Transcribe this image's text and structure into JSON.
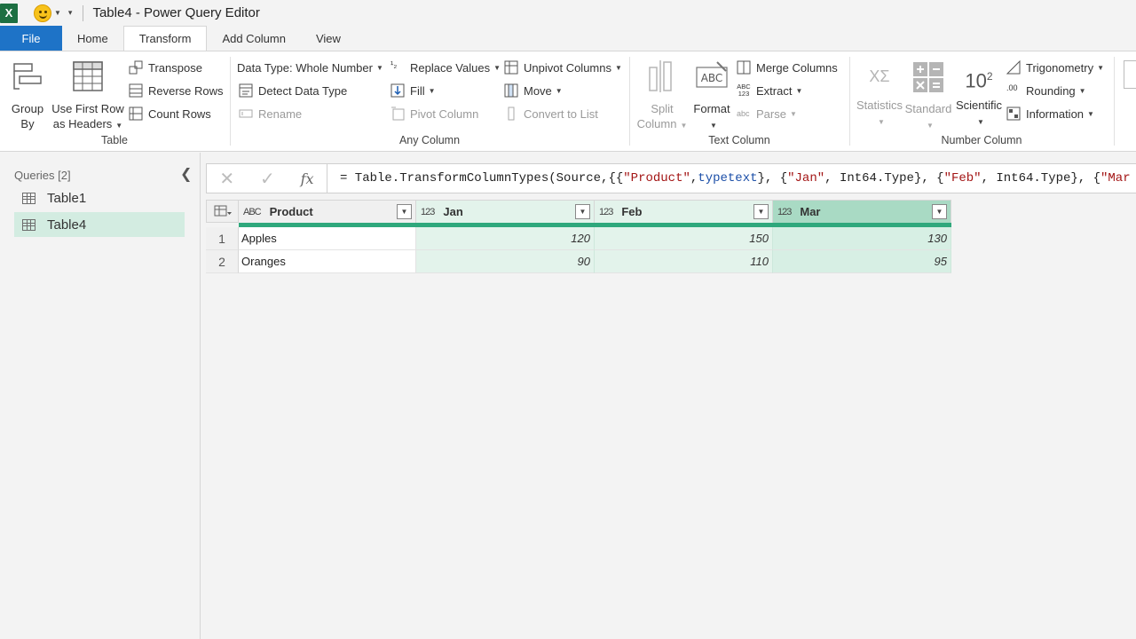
{
  "window": {
    "app_icon_letter": "X",
    "title": "Table4 - Power Query Editor"
  },
  "tabs": [
    {
      "label": "File"
    },
    {
      "label": "Home"
    },
    {
      "label": "Transform"
    },
    {
      "label": "Add Column"
    },
    {
      "label": "View"
    }
  ],
  "ribbon": {
    "table_group": {
      "label": "Table",
      "group_by": [
        "Group",
        "By"
      ],
      "use_first_row": [
        "Use First Row",
        "as Headers"
      ],
      "transpose": "Transpose",
      "reverse_rows": "Reverse Rows",
      "count_rows": "Count Rows"
    },
    "any_column_group": {
      "label": "Any Column",
      "data_type": "Data Type: Whole Number",
      "detect_data_type": "Detect Data Type",
      "rename": "Rename",
      "replace_values": "Replace Values",
      "fill": "Fill",
      "pivot_column": "Pivot Column",
      "unpivot_columns": "Unpivot Columns",
      "move": "Move",
      "convert_to_list": "Convert to List"
    },
    "text_column_group": {
      "label": "Text Column",
      "split_column": [
        "Split",
        "Column"
      ],
      "format": "Format",
      "merge_columns": "Merge Columns",
      "extract": "Extract",
      "parse": "Parse",
      "abc_icon_text": "ABC",
      "abc123_icon_text": [
        "ABC",
        "123"
      ],
      "abc_small_icon_text": "abc"
    },
    "number_column_group": {
      "label": "Number Column",
      "statistics": "Statistics",
      "standard": "Standard",
      "scientific": "Scientific",
      "scientific_icon_text": "10",
      "scientific_icon_sup": "2",
      "statistics_icon_text": "XΣ",
      "trigonometry": "Trigonometry",
      "rounding": "Rounding",
      "information": "Information"
    }
  },
  "queries": {
    "header": "Queries [2]",
    "items": [
      {
        "name": "Table1",
        "selected": false
      },
      {
        "name": "Table4",
        "selected": true
      }
    ]
  },
  "formula_bar": {
    "formula_parts": [
      {
        "t": "= Table.TransformColumnTypes(Source,{{",
        "c": ""
      },
      {
        "t": "\"Product\"",
        "c": "str"
      },
      {
        "t": ", ",
        "c": ""
      },
      {
        "t": "type",
        "c": "kw"
      },
      {
        "t": " ",
        "c": ""
      },
      {
        "t": "text",
        "c": "kw"
      },
      {
        "t": "}, {",
        "c": ""
      },
      {
        "t": "\"Jan\"",
        "c": "str"
      },
      {
        "t": ", Int64.Type}, {",
        "c": ""
      },
      {
        "t": "\"Feb\"",
        "c": "str"
      },
      {
        "t": ", Int64.Type}, {",
        "c": ""
      },
      {
        "t": "\"Mar",
        "c": "str"
      }
    ]
  },
  "table": {
    "type_icons": {
      "text": "ABC",
      "number": "123"
    },
    "columns": [
      {
        "name": "Product",
        "type": "text"
      },
      {
        "name": "Jan",
        "type": "number"
      },
      {
        "name": "Feb",
        "type": "number"
      },
      {
        "name": "Mar",
        "type": "number"
      }
    ],
    "rows": [
      {
        "index": "1",
        "cells": [
          "Apples",
          "120",
          "150",
          "130"
        ]
      },
      {
        "index": "2",
        "cells": [
          "Oranges",
          "90",
          "110",
          "95"
        ]
      }
    ]
  },
  "colors": {
    "file_tab": "#1e73c7",
    "selected_query": "#d3ece1",
    "selected_column": "#d7efe4",
    "selected_column_header": "#a9dac4",
    "quality_bar": "#2fa87c"
  }
}
